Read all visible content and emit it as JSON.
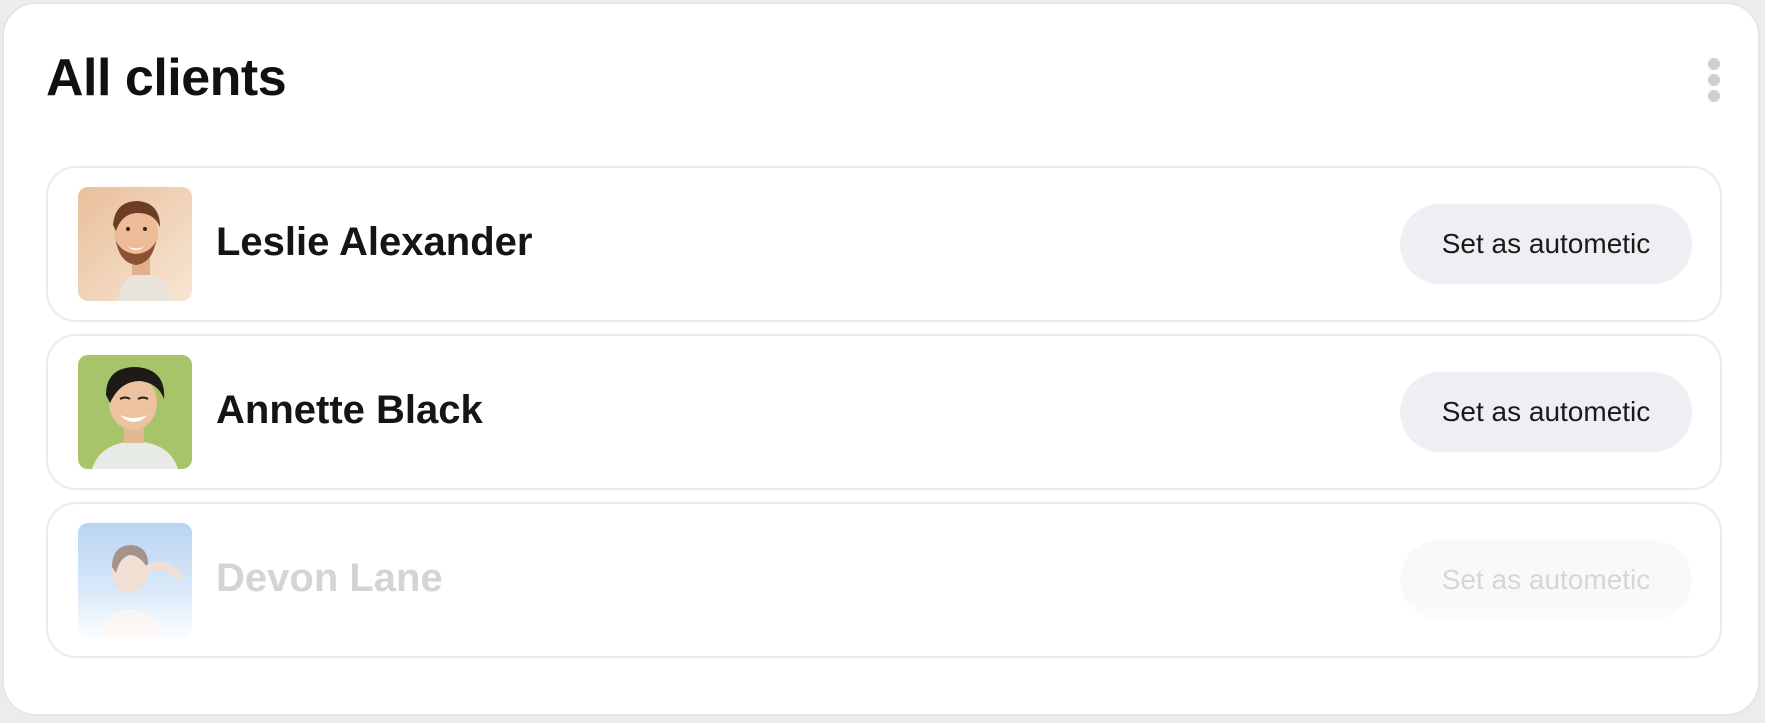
{
  "header": {
    "title": "All clients",
    "menu_icon": "more-vertical-icon"
  },
  "clients": [
    {
      "name": "Leslie Alexander",
      "action_label": "Set as autometic",
      "avatar": "portrait-man-beard",
      "faded": false
    },
    {
      "name": "Annette Black",
      "action_label": "Set as autometic",
      "avatar": "portrait-man-smiling",
      "faded": false
    },
    {
      "name": "Devon Lane",
      "action_label": "Set as autometic",
      "avatar": "portrait-woman-sky",
      "faded": true
    }
  ],
  "colors": {
    "button_bg": "#efeff3",
    "border": "#ebebeb",
    "text": "#151515",
    "faded_text": "#d4d4d4"
  }
}
